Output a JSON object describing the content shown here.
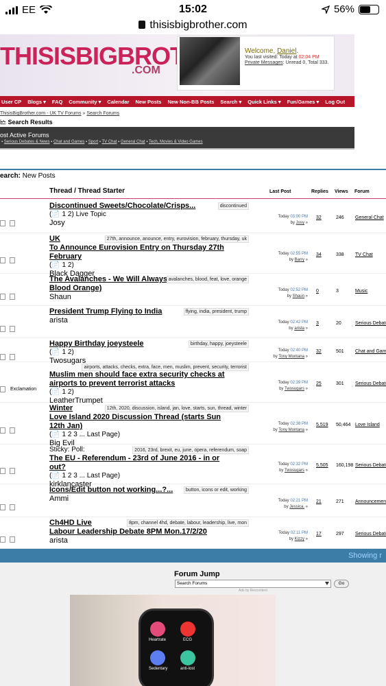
{
  "status_bar": {
    "carrier": "EE",
    "time": "15:02",
    "battery": "56%",
    "battery_level": 0.56
  },
  "browser": {
    "url": "thisisbigbrother.com"
  },
  "header": {
    "logo_main": "THISISBIGBROTHER",
    "logo_suffix": ".COM",
    "welcome_prefix": "Welcome, ",
    "username": "Daniel",
    "welcome_suffix": ".",
    "last_visit_prefix": "You last visited: Today at ",
    "last_visit_time": "02:04 PM",
    "pm_label": "Private Messages",
    "pm_text": ": Unread 0, Total 333."
  },
  "nav": [
    "User CP",
    "Blogs ▾",
    "FAQ",
    "Community ▾",
    "Calendar",
    "New Posts",
    "New Non-BB Posts",
    "Search ▾",
    "Quick Links ▾",
    "Fun/Games ▾",
    "Log Out"
  ],
  "breadcrumb": {
    "site": "ThisisBigBrother.com - UK TV Forums",
    "sep": " » ",
    "current": "Search Forums"
  },
  "search_results_title": "Search Results",
  "most_active": {
    "title": "ost Active Forums",
    "links": [
      "Serious Debates & News",
      "Chat and Games",
      "Sport",
      "TV Chat",
      "General Chat",
      "Tech, Movies & Video Games"
    ]
  },
  "section": {
    "label": "earch:",
    "value": "New Posts"
  },
  "columns": {
    "thread": "Thread / Thread Starter",
    "last_post": "Last Post",
    "replies": "Replies",
    "views": "Views",
    "forum": "Forum"
  },
  "threads": [
    {
      "title": "Discontinued Sweets/Chocolate/Crisps...",
      "tags": "discontinued",
      "pages": "(📄 1 2) Live Topic",
      "starter": "Josy",
      "lp_time": "03:00 PM",
      "lp_by": "Josy",
      "replies": "32",
      "views": "246",
      "forum": "General Chat"
    },
    {
      "title": "UK",
      "title2": "To Announce Eurovision Entry on Thursday 27th February",
      "tags": "27th, announce, anounce, entry, eurovision, february, thursday, uk",
      "pages": "(📄 1 2)",
      "starter": "Black Dagger",
      "lp_time": "02:55 PM",
      "lp_by": "Barry",
      "replies": "34",
      "views": "338",
      "forum": "TV Chat"
    },
    {
      "title": "The Avalanches - We Will Always Love You (feat. Blood Orange)",
      "tags": "avalanches, blood, feat, love, orange",
      "pages": "",
      "starter": "Shaun",
      "lp_time": "02:52 PM",
      "lp_by": "Shaun",
      "replies": "0",
      "views": "3",
      "forum": "Music"
    },
    {
      "title": "President Trump Flying to India",
      "tags": "flying, india, president, trump",
      "pages": "",
      "starter": "arista",
      "lp_time": "02:42 PM",
      "lp_by": "arista",
      "replies": "3",
      "views": "20",
      "forum": "Serious Debates"
    },
    {
      "title": "Happy Birthday joeysteele",
      "tags": "birthday, happy, joeysteele",
      "pages": "(📄 1 2)",
      "starter": "Twosugars",
      "lp_time": "02:40 PM",
      "lp_by": "Tony Montana",
      "replies": "32",
      "views": "501",
      "forum": "Chat and Games"
    },
    {
      "title": "Muslim men should face extra security checks at airports to prevent terrorist attacks",
      "tags": "airports, attacks, checks, extra, face, men, muslim, prevent, security, terrorist",
      "pages": "(📄 1 2)",
      "starter": "LeatherTrumpet",
      "icon_label": "Exclamation",
      "lp_time": "02:39 PM",
      "lp_by": "Twosugars",
      "replies": "25",
      "views": "301",
      "forum": "Serious Debates"
    },
    {
      "title": "Winter",
      "title2": "Love Island 2020 Discussion Thread (starts Sun 12th Jan)",
      "tags": "12th, 2020, discussion, island, jan, love, starts, sun, thread, winter",
      "pages": "(📄 1 2 3 ... Last Page)",
      "starter": "Big Evil",
      "lp_time": "02:38 PM",
      "lp_by": "Tony Montana",
      "replies": "5,519",
      "views": "50,464",
      "forum": "Love Island"
    },
    {
      "prefix": "Sticky: Poll:",
      "title": "The EU - Referendum - 23rd of June 2016 - in or out?",
      "tags": "2016, 23rd, brexit, eu, june, opera, referendum, soap",
      "pages": "(📄 1 2 3 ... Last Page)",
      "starter": "kirklancaster",
      "lp_time": "02:32 PM",
      "lp_by": "Twosugars",
      "replies": "5,505",
      "views": "160,198",
      "forum": "Serious Debates"
    },
    {
      "title": "Icons/Edit button not working...?...",
      "tags": "button, icons or edit, working",
      "pages": "",
      "starter": "Ammi",
      "lp_time": "02:21 PM",
      "lp_by": "Jessica.",
      "replies": "21",
      "views": "271",
      "forum": "Announcements"
    },
    {
      "title": "Ch4HD Live",
      "title2": "Labour Leadership Debate 8PM Mon.17/2/20",
      "tags": "8pm, channel 4hd, debate, labour, leadership, live, mon",
      "pages": "",
      "starter": "arista",
      "lp_time": "02:11 PM",
      "lp_by": "Kizzy",
      "replies": "17",
      "views": "297",
      "forum": "Serious Debates"
    }
  ],
  "last_post_prefix": "Today",
  "by_prefix": "by",
  "showing_text": "Showing r",
  "forum_jump": {
    "title": "Forum Jump",
    "select_value": "Search Forums",
    "go": "Go",
    "ads_by": "Ads by Revcontent"
  },
  "ad": {
    "apps": [
      "Heartrate",
      "ECG",
      "Sedentary",
      "anti-lost"
    ]
  }
}
